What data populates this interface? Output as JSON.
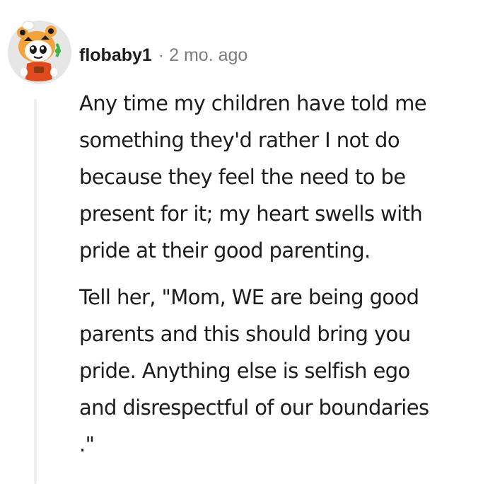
{
  "comment": {
    "username": "flobaby1",
    "separator": "·",
    "timestamp": "2 mo. ago",
    "avatar_icon": "snoo-avatar-icon",
    "paragraphs": [
      [
        "Any time my children have told me",
        "something they'd rather I not do",
        "because they feel the need to be",
        "present for it; my heart swells with",
        "pride at their good parenting."
      ],
      [
        "Tell her, \"Mom, WE are being good",
        "parents and this should bring you",
        "pride. Anything else is selfish ego",
        "and disrespectful of our boundaries",
        ".\""
      ]
    ]
  },
  "colors": {
    "text": "#1c1c1c",
    "meta_text": "#7c7c7c",
    "thread_line": "#edeff1",
    "avatar_bg": "#e6e6e6"
  }
}
